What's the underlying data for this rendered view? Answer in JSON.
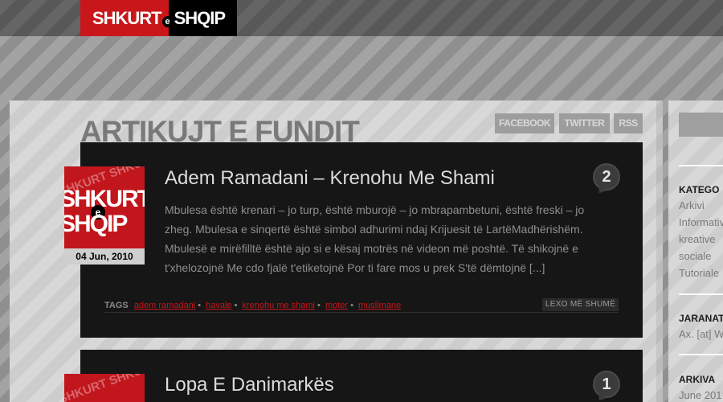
{
  "header": {
    "logo_left": "SHKURT",
    "logo_e": "e",
    "logo_right": "SHQIP"
  },
  "main": {
    "section_title": "ARTIKUJT E FUNDIT",
    "social": {
      "facebook": "FACEBOOK",
      "twitter": "TWITTER",
      "rss": "RSS"
    },
    "posts": [
      {
        "thumb_bg": "SHKURT SHKURT",
        "thumb_line1": "SHKURT",
        "thumb_e": "e",
        "thumb_line2": "SHQIP",
        "date": "04 Jun, 2010",
        "title": "Adem Ramadani – Krenohu Me Shami",
        "comments": "2",
        "excerpt": "Mbulesa është krenari – jo turp, është mburojë – jo mbrapambetuni, është freski – jo zheg. Mbulesa e sinqertë është simbol adhurimi ndaj Krijuesit të LartëMadhërishëm. Mbulesë e mirëfilltë është ajo si e kësaj motrës në videon më poshtë. Të shikojnë e t'xhelozojnë Me cdo fjalë t'etiketojnë Por ti fare mos u prek S'të dëmtojnë [...]",
        "tags_label": "TAGS",
        "tags": [
          "adem ramadani",
          "havale",
          "krenohu me shami",
          "moter",
          "muslimane"
        ],
        "read_more": "LEXO MË SHUMË"
      },
      {
        "thumb_bg": "SHKURT SHKURT",
        "title": "Lopa E Danimarkës",
        "comments": "1"
      }
    ]
  },
  "sidebar": {
    "categories_heading": "KATEGO",
    "categories": [
      "Arkivi",
      "Informativ",
      "kreative",
      "sociale",
      "Tutoriale"
    ],
    "ads_heading": "JARANAT",
    "ads_text": "Ax. [at] W",
    "archive_heading": "ARKIVA",
    "archive_item": "June 201"
  }
}
